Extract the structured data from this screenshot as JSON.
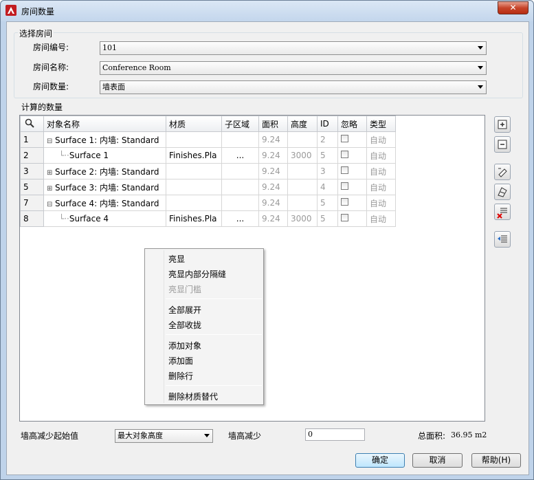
{
  "window": {
    "title": "房间数量",
    "close_label": "✕"
  },
  "select_room": {
    "legend": "选择房间",
    "room_number_label": "房间编号:",
    "room_number_value": "101",
    "room_name_label": "房间名称:",
    "room_name_value": "Conference Room",
    "room_quantity_label": "房间数量:",
    "room_quantity_value": "墙表面"
  },
  "quantities": {
    "legend": "计算的数量",
    "columns": [
      "对象名称",
      "材质",
      "子区域",
      "面积",
      "高度",
      "ID",
      "忽略",
      "类型"
    ],
    "rows": [
      {
        "num": "1",
        "tree": "⊟",
        "name": "Surface 1: 内墙: Standard",
        "material": "",
        "subarea": "",
        "area": "9.24",
        "height": "",
        "id": "2",
        "type": "自动",
        "child": false
      },
      {
        "num": "2",
        "tree": "",
        "name": "Surface 1",
        "material": "Finishes.Pla",
        "subarea": "...",
        "area": "9.24",
        "height": "3000",
        "id": "5",
        "type": "自动",
        "child": true
      },
      {
        "num": "3",
        "tree": "⊞",
        "name": "Surface 2: 内墙: Standard",
        "material": "",
        "subarea": "",
        "area": "9.24",
        "height": "",
        "id": "3",
        "type": "自动",
        "child": false
      },
      {
        "num": "5",
        "tree": "⊞",
        "name": "Surface 3: 内墙: Standard",
        "material": "",
        "subarea": "",
        "area": "9.24",
        "height": "",
        "id": "4",
        "type": "自动",
        "child": false
      },
      {
        "num": "7",
        "tree": "⊟",
        "name": "Surface 4: 内墙: Standard",
        "material": "",
        "subarea": "",
        "area": "9.24",
        "height": "",
        "id": "5",
        "type": "自动",
        "child": false
      },
      {
        "num": "8",
        "tree": "",
        "name": "Surface 4",
        "material": "Finishes.Pla",
        "subarea": "...",
        "area": "9.24",
        "height": "3000",
        "id": "5",
        "type": "自动",
        "child": true
      }
    ]
  },
  "context_menu": {
    "items": [
      "亮显",
      "亮显内部分隔缝",
      "亮显门槛",
      "全部展开",
      "全部收拢",
      "添加对象",
      "添加面",
      "删除行",
      "删除材质替代"
    ]
  },
  "bottom": {
    "wall_reduce_start_label": "墙高减少起始值",
    "wall_reduce_start_value": "最大对象高度",
    "wall_reduce_label": "墙高减少",
    "wall_reduce_value": "0",
    "total_area_label": "总面积:",
    "total_area_value": "36.95 m2"
  },
  "buttons": {
    "ok": "确定",
    "cancel": "取消",
    "help": "帮助(H)"
  },
  "icons": {
    "app": "autocad-icon",
    "search": "magnifier-icon",
    "side": [
      "expand-all-icon",
      "collapse-all-icon",
      "add-object-icon",
      "add-surface-icon",
      "delete-row-icon",
      "delete-material-override-icon"
    ]
  }
}
